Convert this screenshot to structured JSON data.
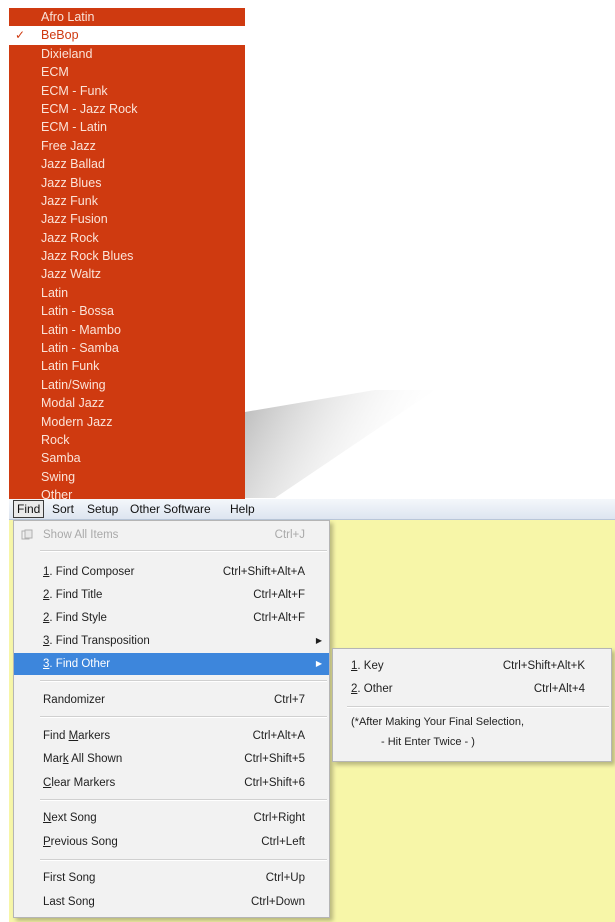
{
  "style_list": {
    "items": [
      "Afro Latin",
      "BeBop",
      "Dixieland",
      "ECM",
      "ECM - Funk",
      "ECM - Jazz Rock",
      "ECM - Latin",
      "Free Jazz",
      "Jazz Ballad",
      "Jazz Blues",
      "Jazz Funk",
      "Jazz Fusion",
      "Jazz Rock",
      "Jazz Rock Blues",
      "Jazz Waltz",
      "Latin",
      "Latin - Bossa",
      "Latin - Mambo",
      "Latin - Samba",
      "Latin Funk",
      "Latin/Swing",
      "Modal Jazz",
      "Modern Jazz",
      "Rock",
      "Samba",
      "Swing",
      "Other"
    ],
    "checked": "BeBop",
    "check_mark": "✓",
    "bg_color": "#cf3a10"
  },
  "menubar": {
    "items": [
      "Find",
      "Sort",
      "Setup",
      "Other Software",
      "Help"
    ],
    "open": "Find"
  },
  "find_menu": {
    "show_all": {
      "label": "Show All Items",
      "shortcut": "Ctrl+J",
      "disabled": true
    },
    "find_composer": {
      "mnemonic": "1",
      "rest": ". Find Composer",
      "shortcut": "Ctrl+Shift+Alt+A"
    },
    "find_title": {
      "mnemonic": "2",
      "rest": ". Find Title",
      "shortcut": "Ctrl+Alt+F"
    },
    "find_style": {
      "mnemonic": "2",
      "rest": ". Find Style",
      "shortcut": "Ctrl+Alt+F"
    },
    "find_transposition": {
      "mnemonic": "3",
      "rest": ". Find Transposition"
    },
    "find_other": {
      "mnemonic": "3",
      "rest": ". Find Other",
      "highlighted": true
    },
    "randomizer": {
      "label": "Randomizer",
      "shortcut": "Ctrl+7"
    },
    "find_markers": {
      "pre": "Find ",
      "mnemonic": "M",
      "rest": "arkers",
      "shortcut": "Ctrl+Alt+A"
    },
    "mark_all_shown": {
      "pre": "Mar",
      "mnemonic": "k",
      "rest": " All Shown",
      "shortcut": "Ctrl+Shift+5"
    },
    "clear_markers": {
      "mnemonic": "C",
      "rest": "lear Markers",
      "shortcut": "Ctrl+Shift+6"
    },
    "next_song": {
      "mnemonic": "N",
      "rest": "ext Song",
      "shortcut": "Ctrl+Right"
    },
    "previous_song": {
      "mnemonic": "P",
      "rest": "revious Song",
      "shortcut": "Ctrl+Left"
    },
    "first_song": {
      "label": "First Song",
      "shortcut": "Ctrl+Up"
    },
    "last_song": {
      "label": "Last Song",
      "shortcut": "Ctrl+Down"
    },
    "highlight_color": "#3d86dc"
  },
  "submenu": {
    "key": {
      "mnemonic": "1",
      "rest": ". Key",
      "shortcut": "Ctrl+Shift+Alt+K"
    },
    "other": {
      "mnemonic": "2",
      "rest": ". Other",
      "shortcut": "Ctrl+Alt+4"
    },
    "note_line1": "(*After Making Your Final Selection,",
    "note_line2": "- Hit Enter Twice -    )"
  },
  "workspace_color": "#f7f6a8"
}
